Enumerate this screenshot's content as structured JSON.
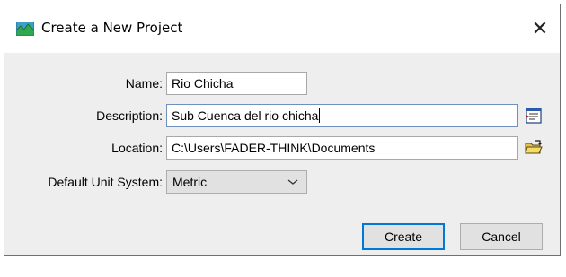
{
  "window": {
    "title": "Create a New Project",
    "close_glyph": "✕"
  },
  "form": {
    "name": {
      "label": "Name:",
      "value": "Rio Chicha"
    },
    "description": {
      "label": "Description:",
      "value": "Sub Cuenca del rio chicha"
    },
    "location": {
      "label": "Location:",
      "value": "C:\\Users\\FADER-THINK\\Documents"
    },
    "unit_system": {
      "label": "Default Unit System:",
      "value": "Metric"
    }
  },
  "buttons": {
    "create": "Create",
    "cancel": "Cancel"
  },
  "icons": {
    "app": "landscape-icon",
    "description_editor": "text-editor-icon",
    "browse": "open-folder-icon",
    "dropdown": "chevron-down-icon"
  },
  "colors": {
    "accent": "#0078d7",
    "dialog_bg": "#eeeeee",
    "titlebar_bg": "#ffffff"
  }
}
